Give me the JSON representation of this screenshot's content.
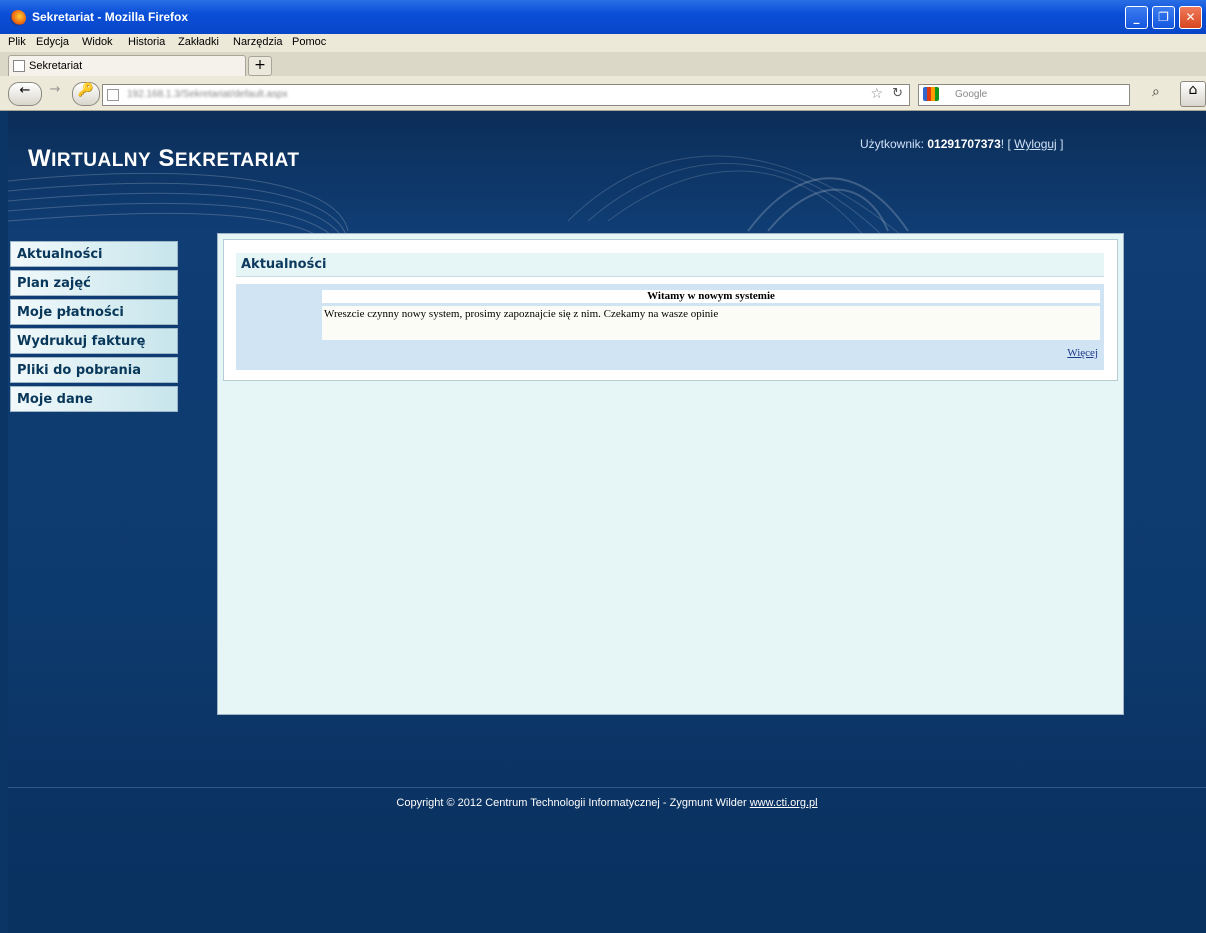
{
  "window": {
    "title": "Sekretariat - Mozilla Firefox",
    "minimize": "_",
    "restore": "❐",
    "close": "✕"
  },
  "menubar": [
    "Plik",
    "Edycja",
    "Widok",
    "Historia",
    "Zakładki",
    "Narzędzia",
    "Pomoc"
  ],
  "tab": {
    "label": "Sekretariat",
    "new_tab": "+"
  },
  "nav": {
    "back": "←",
    "forward": "→",
    "url": "192.168.1.3/Sekretariat/default.aspx",
    "search_placeholder": "Google",
    "reload": "↻",
    "star": "☆",
    "magnify": "⌕",
    "home": "⌂"
  },
  "site": {
    "brand_w": "W",
    "brand_rest1": "IRTUALNY",
    "brand_s": "S",
    "brand_rest2": "EKRETARIAT",
    "user_label": "Użytkownik:",
    "user_id": "01291707373",
    "user_suffix": "! [",
    "logout": "Wyloguj",
    "logout_close": "]"
  },
  "sidebar": {
    "items": [
      {
        "label": "Aktualności"
      },
      {
        "label": "Plan zajęć"
      },
      {
        "label": "Moje płatności"
      },
      {
        "label": "Wydrukuj fakturę"
      },
      {
        "label": "Pliki do pobrania"
      },
      {
        "label": "Moje dane"
      }
    ]
  },
  "content": {
    "title": "Aktualności",
    "news": {
      "headline": "Witamy w nowym systemie",
      "body": "Wreszcie czynny nowy system, prosimy zapoznajcie się z nim. Czekamy na wasze opinie",
      "more": "Więcej"
    }
  },
  "footer": {
    "text": "Copyright © 2012 Centrum Technologii Informatycznej - Zygmunt Wilder",
    "link": "www.cti.org.pl"
  }
}
